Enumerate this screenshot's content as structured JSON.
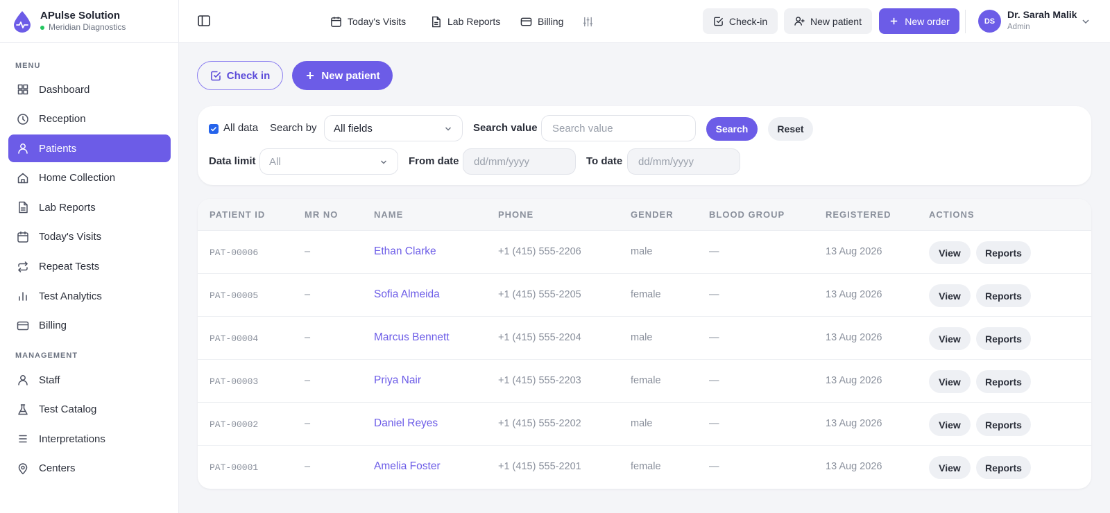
{
  "brand": {
    "name": "APulse Solution",
    "subtitle": "Meridian Diagnostics",
    "accent": "#6c5ce7"
  },
  "sidebar": {
    "menu_label": "MENU",
    "management_label": "MANAGEMENT",
    "menu_items": [
      {
        "label": "Dashboard",
        "icon": "grid-icon"
      },
      {
        "label": "Reception",
        "icon": "clock-icon"
      },
      {
        "label": "Patients",
        "icon": "user-icon",
        "active": true
      },
      {
        "label": "Home Collection",
        "icon": "home-icon"
      },
      {
        "label": "Lab Reports",
        "icon": "file-icon"
      },
      {
        "label": "Today's Visits",
        "icon": "calendar-icon"
      },
      {
        "label": "Repeat Tests",
        "icon": "repeat-icon"
      },
      {
        "label": "Test Analytics",
        "icon": "bar-chart-icon"
      },
      {
        "label": "Billing",
        "icon": "card-icon"
      }
    ],
    "management_items": [
      {
        "label": "Staff",
        "icon": "user-icon"
      },
      {
        "label": "Test Catalog",
        "icon": "flask-icon"
      },
      {
        "label": "Interpretations",
        "icon": "list-icon"
      },
      {
        "label": "Centers",
        "icon": "map-pin-icon"
      }
    ]
  },
  "topbar": {
    "links": [
      "Today's Visits",
      "Lab Reports",
      "Billing"
    ],
    "checkin_label": "Check-in",
    "new_patient_label": "New patient",
    "new_order_label": "New order",
    "user": {
      "initials": "DS",
      "name": "Dr. Sarah Malik",
      "role": "Admin"
    }
  },
  "actions": {
    "check_in": "Check in",
    "new_patient": "New patient"
  },
  "filters": {
    "all_data_label": "All data",
    "all_data_checked": true,
    "search_by_label": "Search by",
    "search_by_value": "All fields",
    "search_value_label": "Search value",
    "search_value_placeholder": "Search value",
    "search_button": "Search",
    "reset_button": "Reset",
    "data_limit_label": "Data limit",
    "data_limit_value": "All",
    "from_date_label": "From date",
    "from_date_placeholder": "dd/mm/yyyy",
    "to_date_label": "To date",
    "to_date_placeholder": "dd/mm/yyyy"
  },
  "table": {
    "columns": [
      "PATIENT ID",
      "MR NO",
      "NAME",
      "PHONE",
      "GENDER",
      "BLOOD GROUP",
      "REGISTERED",
      "ACTIONS"
    ],
    "view_label": "View",
    "reports_label": "Reports",
    "rows": [
      {
        "id": "PAT-00006",
        "mr": "–",
        "name": "Ethan Clarke",
        "phone": "+1 (415) 555-2206",
        "gender": "male",
        "blood": "—",
        "registered": "13 Aug 2026"
      },
      {
        "id": "PAT-00005",
        "mr": "–",
        "name": "Sofia Almeida",
        "phone": "+1 (415) 555-2205",
        "gender": "female",
        "blood": "—",
        "registered": "13 Aug 2026"
      },
      {
        "id": "PAT-00004",
        "mr": "–",
        "name": "Marcus Bennett",
        "phone": "+1 (415) 555-2204",
        "gender": "male",
        "blood": "—",
        "registered": "13 Aug 2026"
      },
      {
        "id": "PAT-00003",
        "mr": "–",
        "name": "Priya Nair",
        "phone": "+1 (415) 555-2203",
        "gender": "female",
        "blood": "—",
        "registered": "13 Aug 2026"
      },
      {
        "id": "PAT-00002",
        "mr": "–",
        "name": "Daniel Reyes",
        "phone": "+1 (415) 555-2202",
        "gender": "male",
        "blood": "—",
        "registered": "13 Aug 2026"
      },
      {
        "id": "PAT-00001",
        "mr": "–",
        "name": "Amelia Foster",
        "phone": "+1 (415) 555-2201",
        "gender": "female",
        "blood": "—",
        "registered": "13 Aug 2026"
      }
    ]
  }
}
